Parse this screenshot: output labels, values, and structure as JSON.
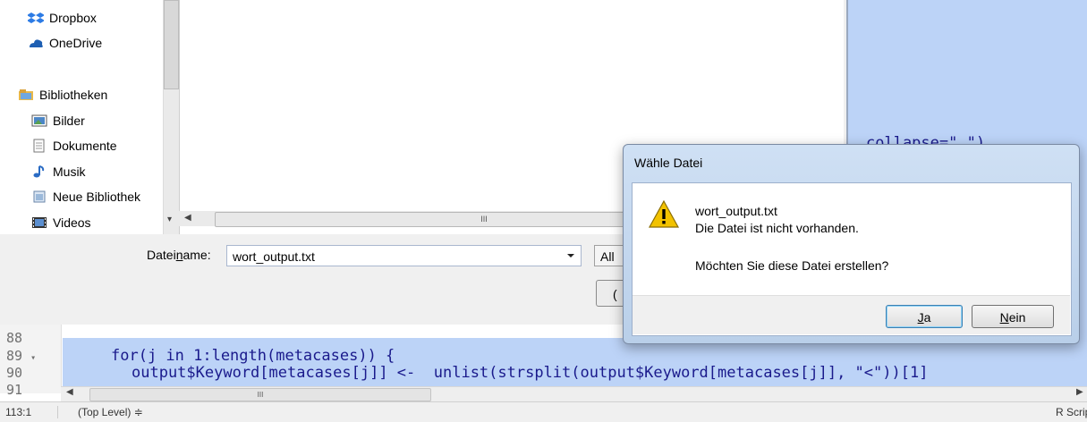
{
  "editor": {
    "line_numbers": [
      "88",
      "89",
      "90",
      "91"
    ],
    "fold_marker": "▾",
    "code_line_89": "for(j in 1:length(metacases)) {",
    "code_line_90": "output$Keyword[metacases[j]] <-  unlist(strsplit(output$Keyword[metacases[j]], \"<\"))[1]",
    "code_partial": "collapse=\" \")",
    "hscroll_grip": "III"
  },
  "status": {
    "position": "113:1",
    "scope": "(Top Level) ≑",
    "file_type": "R Script"
  },
  "save_dialog": {
    "nav_items": [
      {
        "label": "Dropbox",
        "icon": "dropbox-icon"
      },
      {
        "label": "OneDrive",
        "icon": "onedrive-icon"
      },
      {
        "label": "Bibliotheken",
        "icon": "libraries-icon"
      },
      {
        "label": "Bilder",
        "icon": "pictures-icon"
      },
      {
        "label": "Dokumente",
        "icon": "documents-icon"
      },
      {
        "label": "Musik",
        "icon": "music-icon"
      },
      {
        "label": "Neue Bibliothek",
        "icon": "new-library-icon"
      },
      {
        "label": "Videos",
        "icon": "videos-icon"
      }
    ],
    "filename_label_pre": "Datei",
    "filename_label_u": "n",
    "filename_label_post": "ame:",
    "filename_value": "wort_output.txt",
    "filetype_partial": "All",
    "save_button_partial": "(",
    "file_scroll_grip": "III"
  },
  "confirm": {
    "title": "Wähle Datei",
    "file": "wort_output.txt",
    "line1": "Die Datei ist nicht vorhanden.",
    "line2": "Möchten Sie diese Datei erstellen?",
    "yes_u": "J",
    "yes_rest": "a",
    "no_u": "N",
    "no_rest": "ein"
  },
  "colors": {
    "selection": "#bcd3f7",
    "dialog_frame": "#b9cfe9",
    "warning": "#f2c200"
  }
}
